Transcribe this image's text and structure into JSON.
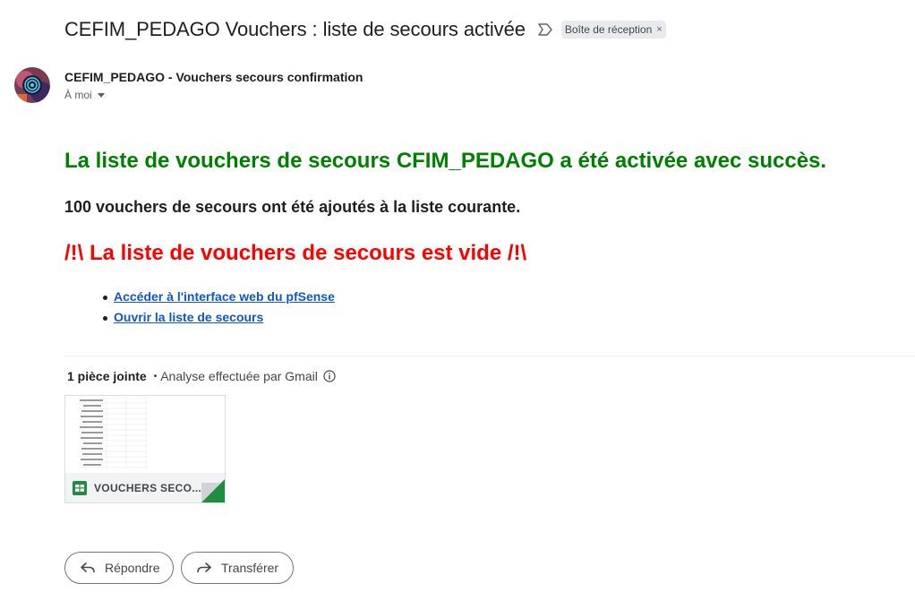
{
  "email": {
    "subject": "CEFIM_PEDAGO Vouchers : liste de secours activée",
    "label": "Boîte de réception",
    "label_remove": "×",
    "sender_name": "CEFIM_PEDAGO - Vouchers secours confirmation",
    "recipient": "À moi"
  },
  "body": {
    "heading_success": "La liste de vouchers de secours CFIM_PEDAGO a été activée avec succès.",
    "added_text": "100 vouchers de secours ont été ajoutés à la liste courante.",
    "warning": "/!\\ La liste de vouchers de secours est vide /!\\",
    "links": [
      "Accéder à l'interface web du pfSense",
      "Ouvrir la liste de secours"
    ]
  },
  "attachments": {
    "count_label": "1 pièce jointe",
    "separator": "•",
    "scan_text": "Analyse effectuée par Gmail",
    "file_name": "VOUCHERS SECO..."
  },
  "actions": {
    "reply": "Répondre",
    "forward": "Transférer"
  },
  "colors": {
    "success": "#008000",
    "warning": "#ff0000",
    "link": "#1155cc"
  },
  "icons": [
    "importance-marker-icon",
    "info-icon",
    "google-sheets-icon",
    "reply-icon",
    "forward-icon"
  ]
}
